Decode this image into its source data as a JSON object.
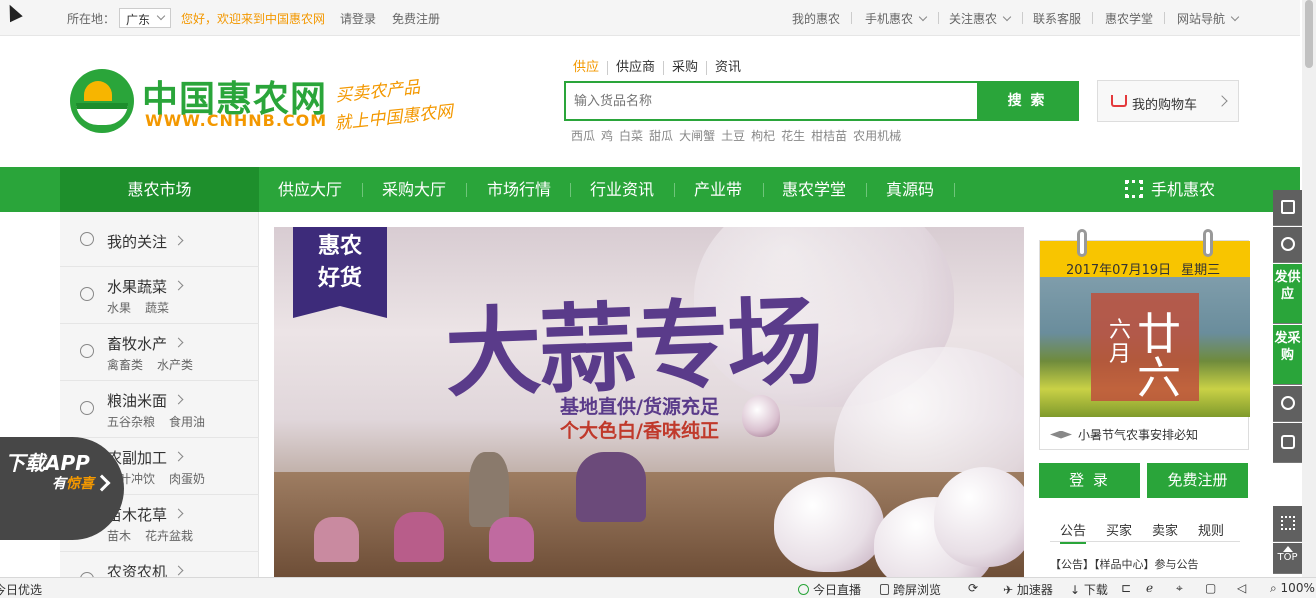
{
  "topbar": {
    "location_label": "所在地：",
    "city": "广东",
    "welcome": "您好，欢迎来到中国惠农网",
    "login": "请登录",
    "register": "免费注册",
    "links": [
      "我的惠农",
      "手机惠农",
      "关注惠农",
      "联系客服",
      "惠农学堂",
      "网站导航"
    ]
  },
  "logo": {
    "cn": "中国惠农网",
    "en": "WWW.CNHNB.COM",
    "slogan_line1": "买卖农产品",
    "slogan_line2": "就上中国惠农网"
  },
  "search": {
    "tabs": [
      "供应",
      "供应商",
      "采购",
      "资讯"
    ],
    "active_tab": "供应",
    "placeholder": "输入货品名称",
    "button": "搜 索",
    "hotwords": [
      "西瓜",
      "鸡",
      "白菜",
      "甜瓜",
      "大闸蟹",
      "土豆",
      "枸杞",
      "花生",
      "柑桔苗",
      "农用机械"
    ]
  },
  "cart": {
    "label": "我的购物车"
  },
  "nav": {
    "market": "惠农市场",
    "items": [
      "供应大厅",
      "采购大厅",
      "市场行情",
      "行业资讯",
      "产业带",
      "惠农学堂",
      "真源码"
    ],
    "mobile": "手机惠农"
  },
  "sidebar": {
    "follow": "我的关注",
    "categories": [
      {
        "title": "水果蔬菜",
        "subs": [
          "水果",
          "蔬菜"
        ]
      },
      {
        "title": "畜牧水产",
        "subs": [
          "禽畜类",
          "水产类"
        ]
      },
      {
        "title": "粮油米面",
        "subs": [
          "五谷杂粮",
          "食用油"
        ]
      },
      {
        "title": "农副加工",
        "subs": [
          "茶叶冲饮",
          "肉蛋奶"
        ]
      },
      {
        "title": "苗木花草",
        "subs": [
          "苗木",
          "花卉盆栽"
        ]
      },
      {
        "title": "农资农机",
        "subs": []
      }
    ]
  },
  "app_badge": {
    "line1": "下载APP",
    "line2_a": "有",
    "line2_b": "惊喜"
  },
  "banner": {
    "badge_line1": "惠农",
    "badge_line2": "好货",
    "title": "大蒜专场",
    "sub1": "基地直供/货源充足",
    "sub2": "个大色白/香味纯正"
  },
  "calendar": {
    "date": "2017年07月19日",
    "weekday": "星期三",
    "lunar_month": "六月",
    "lunar_day": "廿六",
    "tip": "小暑节气农事安排必知"
  },
  "account": {
    "login": "登 录",
    "register": "免费注册"
  },
  "notice": {
    "tabs": [
      "公告",
      "买家",
      "卖家",
      "规则"
    ],
    "active": "公告",
    "line": "【公告】【样品中心】参与公告"
  },
  "rightbar": {
    "post_supply": "发供应",
    "post_purchase": "发采购",
    "top": "TOP"
  },
  "statusbar": {
    "left": "今日优选",
    "live": "今日直播",
    "cross": "跨屏浏览",
    "accel": "加速器",
    "download": "下载",
    "zoom": "100%"
  }
}
